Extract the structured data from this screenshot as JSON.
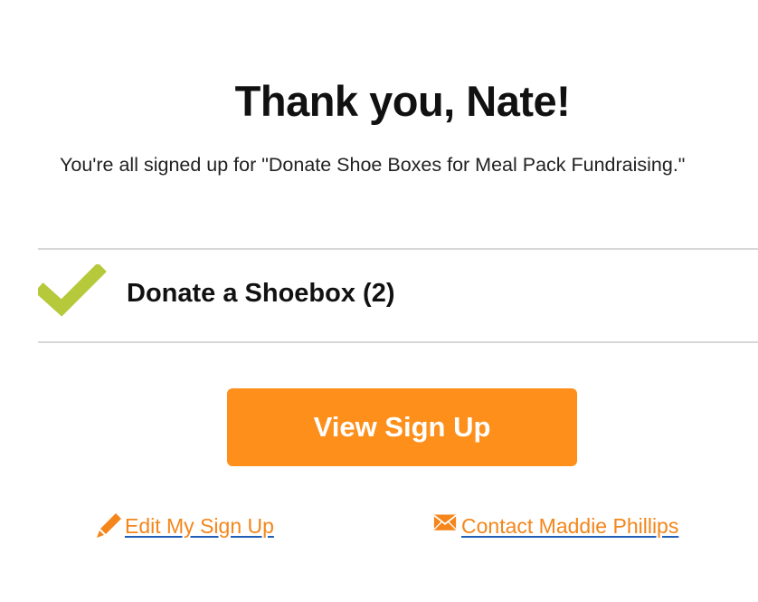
{
  "heading": "Thank you, Nate!",
  "confirmation_text": "You're all signed up for \"Donate Shoe Boxes for Meal Pack Fundraising.\"",
  "signup_item": {
    "label": "Donate a Shoebox (2)",
    "icon": "checkmark-icon"
  },
  "view_button_label": "View Sign Up",
  "links": {
    "edit_label": " Edit My Sign Up",
    "edit_icon": "pencil-icon",
    "contact_label": " Contact Maddie Phillips",
    "contact_icon": "envelope-icon"
  },
  "colors": {
    "accent": "#fd8f1a",
    "link_text": "#f4861b",
    "link_underline": "#1f5fb8",
    "check": "#b5c93b",
    "divider": "#d8d8d8"
  }
}
